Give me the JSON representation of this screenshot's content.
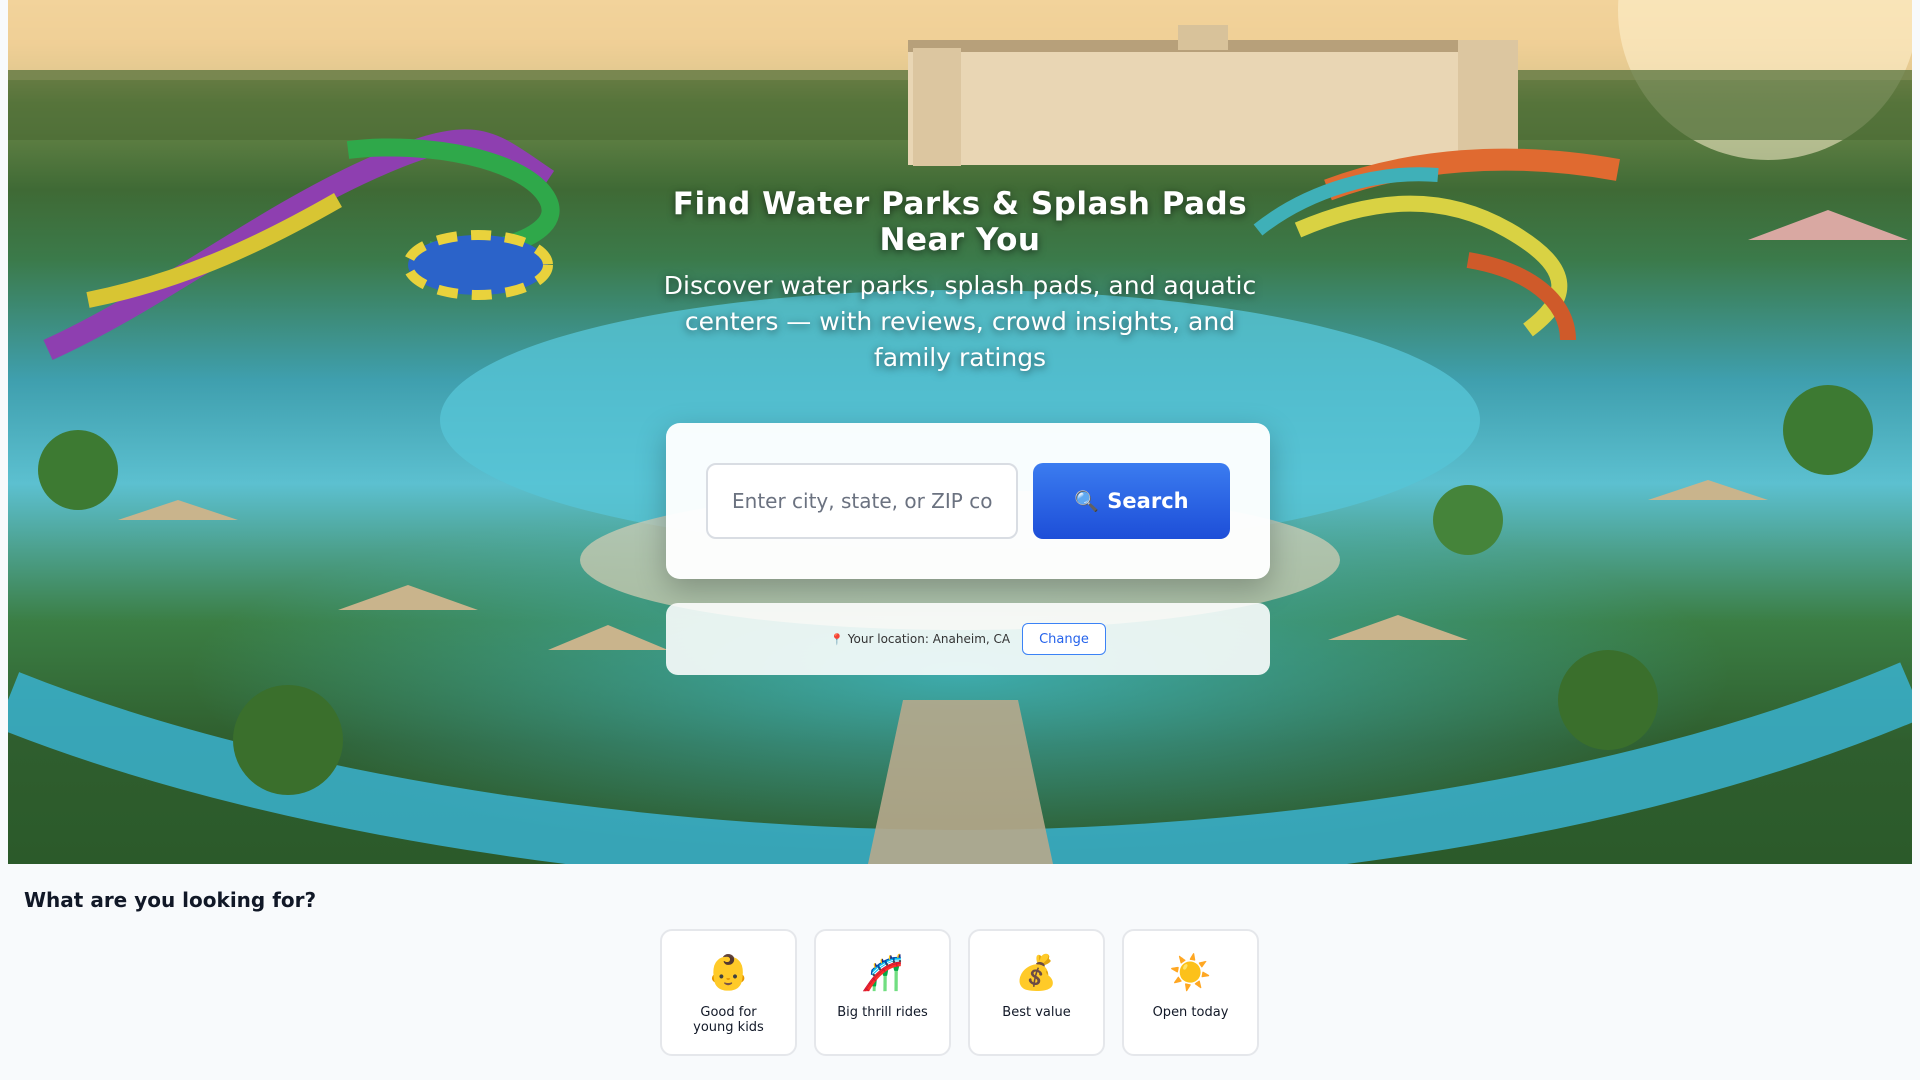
{
  "hero": {
    "title": "Find Water Parks & Splash Pads Near You",
    "subtitle": "Discover water parks, splash pads, and aquatic centers — with reviews, crowd insights, and family ratings"
  },
  "search": {
    "placeholder": "Enter city, state, or ZIP code",
    "value": "",
    "button_icon": "🔍",
    "button_label": "Search"
  },
  "location": {
    "pin_icon": "📍",
    "text": "Your location: Anaheim, CA",
    "change_label": "Change"
  },
  "filters_section": {
    "title": "What are you looking for?",
    "items": [
      {
        "icon": "👶",
        "icon_name": "baby-icon",
        "label": "Good for young kids"
      },
      {
        "icon": "🎢",
        "icon_name": "roller-coaster-icon",
        "label": "Big thrill rides"
      },
      {
        "icon": "💰",
        "icon_name": "money-bag-icon",
        "label": "Best value"
      },
      {
        "icon": "☀️",
        "icon_name": "sun-icon",
        "label": "Open today"
      }
    ]
  },
  "colors": {
    "primary_button": "#1d4ed8",
    "link_blue": "#2563eb",
    "page_background": "#f8fafc"
  }
}
